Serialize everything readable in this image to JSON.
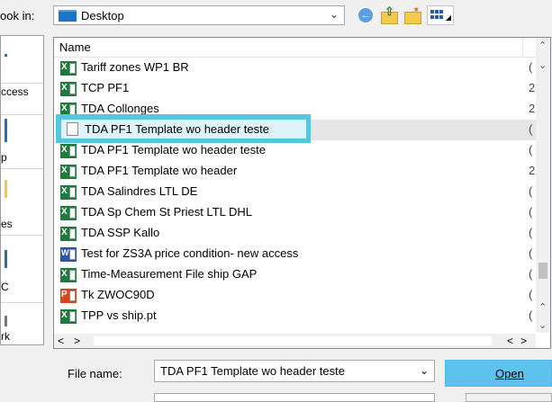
{
  "toolbar": {
    "look_in_label": "ook in:",
    "look_in_value": "Desktop"
  },
  "places": [
    {
      "label": "",
      "icon": "recent-icon"
    },
    {
      "label": "ccess",
      "icon": "quick-access-icon"
    },
    {
      "label": "p",
      "icon": "desktop-icon"
    },
    {
      "label": "es",
      "icon": "libraries-icon"
    },
    {
      "label": "C",
      "icon": "computer-icon"
    },
    {
      "label": "rk",
      "icon": "network-icon"
    }
  ],
  "list": {
    "column_name": "Name",
    "rows": [
      {
        "name": "Tariff zones WP1 BR",
        "icon": "excel-icon",
        "col2": "("
      },
      {
        "name": "TCP PF1",
        "icon": "excel-icon",
        "col2": "2"
      },
      {
        "name": "TDA Collonges",
        "icon": "excel-icon",
        "col2": "2"
      },
      {
        "name": "",
        "icon": "document-icon",
        "col2": "("
      },
      {
        "name": "TDA PF1 Template wo header teste",
        "icon": "excel-icon",
        "col2": "("
      },
      {
        "name": "TDA PF1 Template wo header",
        "icon": "excel-icon",
        "col2": "2"
      },
      {
        "name": "TDA Salindres LTL DE",
        "icon": "excel-icon",
        "col2": "("
      },
      {
        "name": "TDA Sp Chem St Priest LTL DHL",
        "icon": "excel-icon",
        "col2": "("
      },
      {
        "name": "TDA SSP Kallo",
        "icon": "excel-icon",
        "col2": "("
      },
      {
        "name": "Test for ZS3A price condition- new access",
        "icon": "word-icon",
        "col2": "("
      },
      {
        "name": "Time-Measurement File ship GAP",
        "icon": "excel-icon",
        "col2": "("
      },
      {
        "name": "Tk ZWOC90D",
        "icon": "powerpoint-icon",
        "col2": "("
      },
      {
        "name": "TPP vs ship.pt",
        "icon": "excel-icon",
        "col2": "("
      }
    ],
    "tooltip_text": "TDA PF1 Template wo header teste"
  },
  "footer": {
    "file_name_label": "File name:",
    "file_name_value": "TDA PF1 Template wo header teste",
    "open_label": "Open"
  }
}
